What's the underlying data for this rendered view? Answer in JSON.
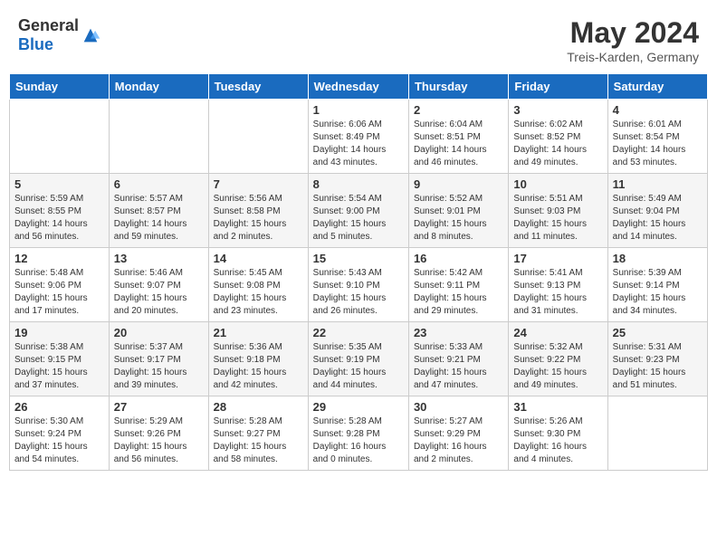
{
  "header": {
    "logo_general": "General",
    "logo_blue": "Blue",
    "month_title": "May 2024",
    "location": "Treis-Karden, Germany"
  },
  "days_of_week": [
    "Sunday",
    "Monday",
    "Tuesday",
    "Wednesday",
    "Thursday",
    "Friday",
    "Saturday"
  ],
  "weeks": [
    [
      {
        "day": "",
        "info": ""
      },
      {
        "day": "",
        "info": ""
      },
      {
        "day": "",
        "info": ""
      },
      {
        "day": "1",
        "info": "Sunrise: 6:06 AM\nSunset: 8:49 PM\nDaylight: 14 hours\nand 43 minutes."
      },
      {
        "day": "2",
        "info": "Sunrise: 6:04 AM\nSunset: 8:51 PM\nDaylight: 14 hours\nand 46 minutes."
      },
      {
        "day": "3",
        "info": "Sunrise: 6:02 AM\nSunset: 8:52 PM\nDaylight: 14 hours\nand 49 minutes."
      },
      {
        "day": "4",
        "info": "Sunrise: 6:01 AM\nSunset: 8:54 PM\nDaylight: 14 hours\nand 53 minutes."
      }
    ],
    [
      {
        "day": "5",
        "info": "Sunrise: 5:59 AM\nSunset: 8:55 PM\nDaylight: 14 hours\nand 56 minutes."
      },
      {
        "day": "6",
        "info": "Sunrise: 5:57 AM\nSunset: 8:57 PM\nDaylight: 14 hours\nand 59 minutes."
      },
      {
        "day": "7",
        "info": "Sunrise: 5:56 AM\nSunset: 8:58 PM\nDaylight: 15 hours\nand 2 minutes."
      },
      {
        "day": "8",
        "info": "Sunrise: 5:54 AM\nSunset: 9:00 PM\nDaylight: 15 hours\nand 5 minutes."
      },
      {
        "day": "9",
        "info": "Sunrise: 5:52 AM\nSunset: 9:01 PM\nDaylight: 15 hours\nand 8 minutes."
      },
      {
        "day": "10",
        "info": "Sunrise: 5:51 AM\nSunset: 9:03 PM\nDaylight: 15 hours\nand 11 minutes."
      },
      {
        "day": "11",
        "info": "Sunrise: 5:49 AM\nSunset: 9:04 PM\nDaylight: 15 hours\nand 14 minutes."
      }
    ],
    [
      {
        "day": "12",
        "info": "Sunrise: 5:48 AM\nSunset: 9:06 PM\nDaylight: 15 hours\nand 17 minutes."
      },
      {
        "day": "13",
        "info": "Sunrise: 5:46 AM\nSunset: 9:07 PM\nDaylight: 15 hours\nand 20 minutes."
      },
      {
        "day": "14",
        "info": "Sunrise: 5:45 AM\nSunset: 9:08 PM\nDaylight: 15 hours\nand 23 minutes."
      },
      {
        "day": "15",
        "info": "Sunrise: 5:43 AM\nSunset: 9:10 PM\nDaylight: 15 hours\nand 26 minutes."
      },
      {
        "day": "16",
        "info": "Sunrise: 5:42 AM\nSunset: 9:11 PM\nDaylight: 15 hours\nand 29 minutes."
      },
      {
        "day": "17",
        "info": "Sunrise: 5:41 AM\nSunset: 9:13 PM\nDaylight: 15 hours\nand 31 minutes."
      },
      {
        "day": "18",
        "info": "Sunrise: 5:39 AM\nSunset: 9:14 PM\nDaylight: 15 hours\nand 34 minutes."
      }
    ],
    [
      {
        "day": "19",
        "info": "Sunrise: 5:38 AM\nSunset: 9:15 PM\nDaylight: 15 hours\nand 37 minutes."
      },
      {
        "day": "20",
        "info": "Sunrise: 5:37 AM\nSunset: 9:17 PM\nDaylight: 15 hours\nand 39 minutes."
      },
      {
        "day": "21",
        "info": "Sunrise: 5:36 AM\nSunset: 9:18 PM\nDaylight: 15 hours\nand 42 minutes."
      },
      {
        "day": "22",
        "info": "Sunrise: 5:35 AM\nSunset: 9:19 PM\nDaylight: 15 hours\nand 44 minutes."
      },
      {
        "day": "23",
        "info": "Sunrise: 5:33 AM\nSunset: 9:21 PM\nDaylight: 15 hours\nand 47 minutes."
      },
      {
        "day": "24",
        "info": "Sunrise: 5:32 AM\nSunset: 9:22 PM\nDaylight: 15 hours\nand 49 minutes."
      },
      {
        "day": "25",
        "info": "Sunrise: 5:31 AM\nSunset: 9:23 PM\nDaylight: 15 hours\nand 51 minutes."
      }
    ],
    [
      {
        "day": "26",
        "info": "Sunrise: 5:30 AM\nSunset: 9:24 PM\nDaylight: 15 hours\nand 54 minutes."
      },
      {
        "day": "27",
        "info": "Sunrise: 5:29 AM\nSunset: 9:26 PM\nDaylight: 15 hours\nand 56 minutes."
      },
      {
        "day": "28",
        "info": "Sunrise: 5:28 AM\nSunset: 9:27 PM\nDaylight: 15 hours\nand 58 minutes."
      },
      {
        "day": "29",
        "info": "Sunrise: 5:28 AM\nSunset: 9:28 PM\nDaylight: 16 hours\nand 0 minutes."
      },
      {
        "day": "30",
        "info": "Sunrise: 5:27 AM\nSunset: 9:29 PM\nDaylight: 16 hours\nand 2 minutes."
      },
      {
        "day": "31",
        "info": "Sunrise: 5:26 AM\nSunset: 9:30 PM\nDaylight: 16 hours\nand 4 minutes."
      },
      {
        "day": "",
        "info": ""
      }
    ]
  ]
}
